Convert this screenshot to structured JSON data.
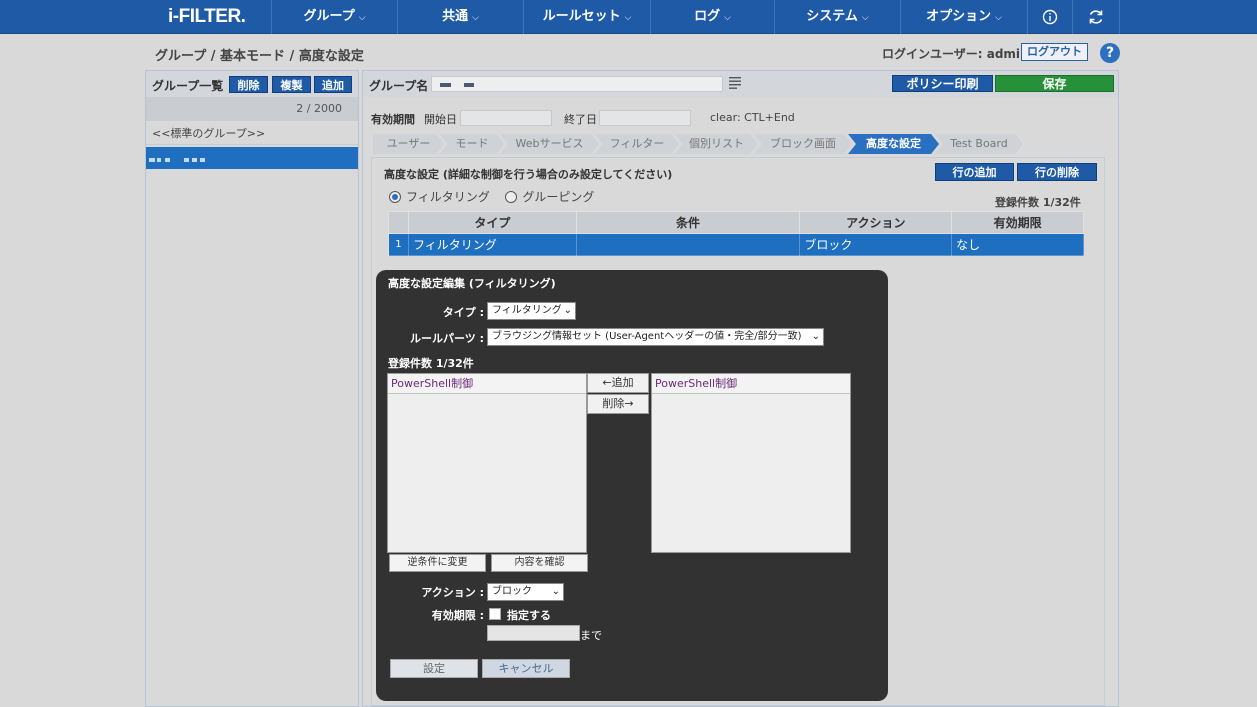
{
  "app": {
    "logo": "i-FILTER."
  },
  "nav": {
    "items": [
      {
        "label": "グループ"
      },
      {
        "label": "共通"
      },
      {
        "label": "ルールセット"
      },
      {
        "label": "ログ"
      },
      {
        "label": "システム"
      },
      {
        "label": "オプション"
      }
    ],
    "chevron": "⌵",
    "info_icon": "info-icon",
    "refresh_icon": "refresh-icon"
  },
  "breadcrumb": "グループ / 基本モード / 高度な設定",
  "login": {
    "label": "ログインユーザー: admin",
    "logout": "ログアウト"
  },
  "help_icon_text": "?",
  "left": {
    "title": "グループ一覧",
    "buttons": {
      "delete": "削除",
      "copy": "複製",
      "add": "追加"
    },
    "count": "2 / 2000",
    "standard_group": "<<標準のグループ>>"
  },
  "main": {
    "group_label": "グループ名 :",
    "print_button": "ポリシー印刷",
    "save_button": "保存",
    "period_label": "有効期間",
    "start_label": "開始日",
    "end_label": "終了日",
    "clear_hint": "clear: CTL+End",
    "tabs": [
      "ユーザー",
      "モード",
      "Webサービス",
      "フィルター",
      "個別リスト",
      "ブロック画面",
      "高度な設定",
      "Test Board"
    ],
    "active_tab": "高度な設定",
    "adv_title": "高度な設定 (詳細な制御を行う場合のみ設定してください)",
    "add_row": "行の追加",
    "delete_row": "行の削除",
    "radio_filtering": "フィルタリング",
    "radio_grouping": "グルーピング",
    "reg_count": "登録件数 1/32件",
    "table": {
      "headers": [
        "タイプ",
        "条件",
        "アクション",
        "有効期限"
      ],
      "rows": [
        {
          "no": "1",
          "type": "フィルタリング",
          "condition": "",
          "action": "ブロック",
          "expiry": "なし"
        }
      ]
    }
  },
  "dialog": {
    "title": "高度な設定編集 (フィルタリング)",
    "type_label": "タイプ :",
    "type_value": "フィルタリング",
    "parts_label": "ルールパーツ :",
    "parts_value": "ブラウジング情報セット (User-Agentヘッダーの値・完全/部分一致)",
    "count": "登録件数 1/32件",
    "left_list": [
      "PowerShell制御"
    ],
    "right_list": [
      "PowerShell制御"
    ],
    "add_button": "←追加",
    "remove_button": "削除→",
    "invert_button": "逆条件に変更",
    "confirm_button": "内容を確認",
    "action_label": "アクション :",
    "action_value": "ブロック",
    "expiry_label": "有効期限 :",
    "expiry_check": "指定する",
    "until": "まで",
    "set_button": "設定",
    "cancel_button": "キャンセル"
  },
  "colors": {
    "nav_bg": "#1f5aa6",
    "accent": "#2a6fc0",
    "save_green": "#27913a",
    "dialog_bg": "#323232"
  }
}
